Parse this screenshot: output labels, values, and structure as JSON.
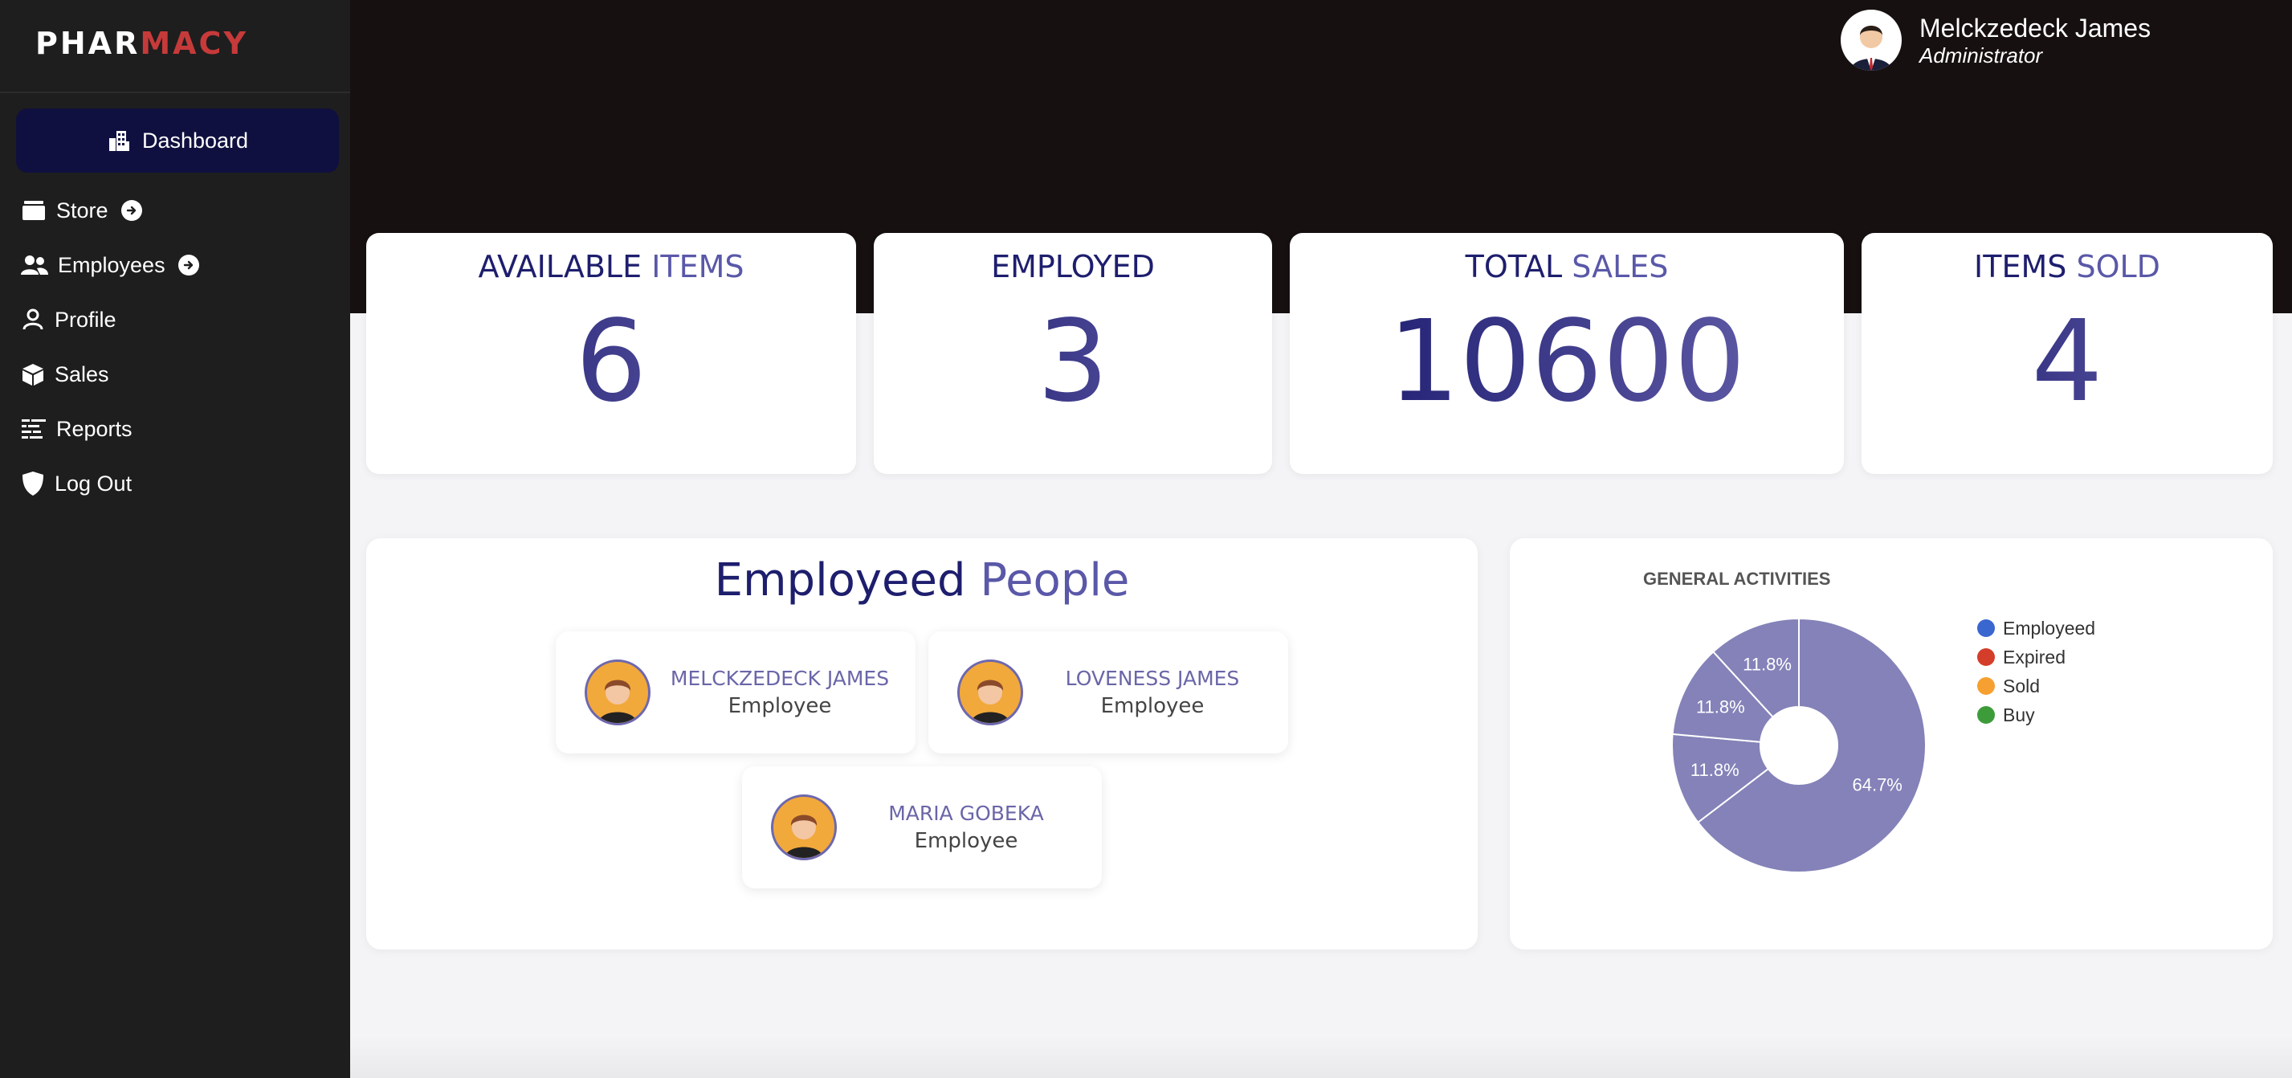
{
  "app": {
    "logo_part1": "PHAR",
    "logo_part2": "MACY"
  },
  "sidebar": {
    "items": [
      {
        "label": "Dashboard",
        "icon": "building-icon",
        "active": true
      },
      {
        "label": "Store",
        "icon": "drawer-icon",
        "has_arrow": true
      },
      {
        "label": "Employees",
        "icon": "people-icon",
        "has_arrow": true
      },
      {
        "label": "Profile",
        "icon": "person-icon"
      },
      {
        "label": "Sales",
        "icon": "box-icon"
      },
      {
        "label": "Reports",
        "icon": "list-icon"
      },
      {
        "label": "Log Out",
        "icon": "shield-icon"
      }
    ]
  },
  "header": {
    "user_name": "Melckzedeck James",
    "user_role": "Administrator"
  },
  "stats": [
    {
      "title_dark": "AVAILABLE",
      "title_light": "ITEMS",
      "value": "6"
    },
    {
      "title_dark": "EMPLOYED",
      "title_light": "",
      "value": "3"
    },
    {
      "title_dark": "TOTAL",
      "title_light": "SALES",
      "value": "10600"
    },
    {
      "title_dark": "ITEMS",
      "title_light": "SOLD",
      "value": "4"
    }
  ],
  "employees": {
    "title_dark": "Employeed",
    "title_light": "People",
    "people": [
      {
        "name": "MELCKZEDECK JAMES",
        "role": "Employee"
      },
      {
        "name": "LOVENESS JAMES",
        "role": "Employee"
      },
      {
        "name": "MARIA GOBEKA",
        "role": "Employee"
      }
    ]
  },
  "colors": {
    "accent_dark": "#1e1e6e",
    "accent_light": "#5a58a8",
    "pie_fill": "#8482b8",
    "logo_red": "#c63a3a"
  },
  "chart_data": {
    "type": "pie",
    "title": "GENERAL ACTIVITIES",
    "donut": true,
    "legend_position": "right",
    "legend": [
      {
        "label": "Employeed",
        "color": "#3a66d0"
      },
      {
        "label": "Expired",
        "color": "#d43d2a"
      },
      {
        "label": "Sold",
        "color": "#f5a030"
      },
      {
        "label": "Buy",
        "color": "#3d9c3a"
      }
    ],
    "slices": [
      {
        "label": "64.7%",
        "value": 64.7
      },
      {
        "label": "11.8%",
        "value": 11.8
      },
      {
        "label": "11.8%",
        "value": 11.8
      },
      {
        "label": "11.8%",
        "value": 11.8
      }
    ]
  }
}
